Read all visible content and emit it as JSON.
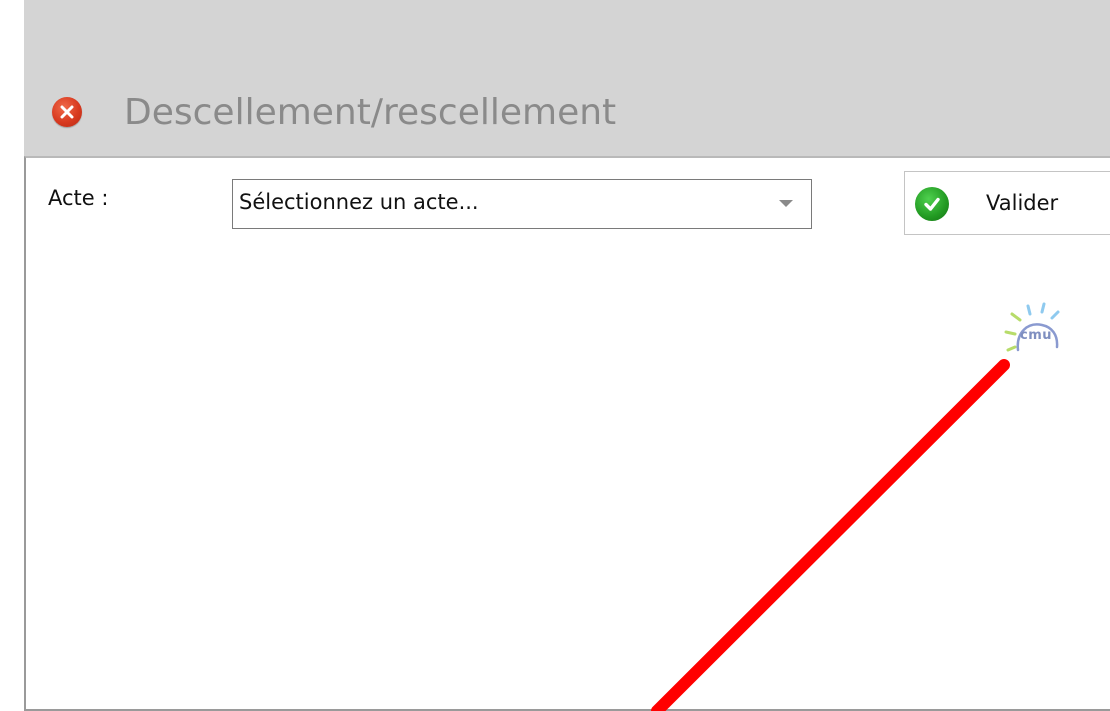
{
  "window": {
    "title": "Descellement/rescellement"
  },
  "form": {
    "acte_label": "Acte :",
    "acte_select_value": "Sélectionnez un acte...",
    "validate_label": "Valider"
  },
  "logo": {
    "text": "cmu"
  },
  "colors": {
    "titlebar_bg": "#d4d4d4",
    "title_text": "#8a8a8a",
    "close_red": "#d83a20",
    "check_green": "#229a22",
    "annotation_red": "#ff0000"
  },
  "icons": {
    "close": "close-icon",
    "validate": "check-icon",
    "select_arrow": "chevron-down-icon",
    "logo": "cmu-logo"
  }
}
